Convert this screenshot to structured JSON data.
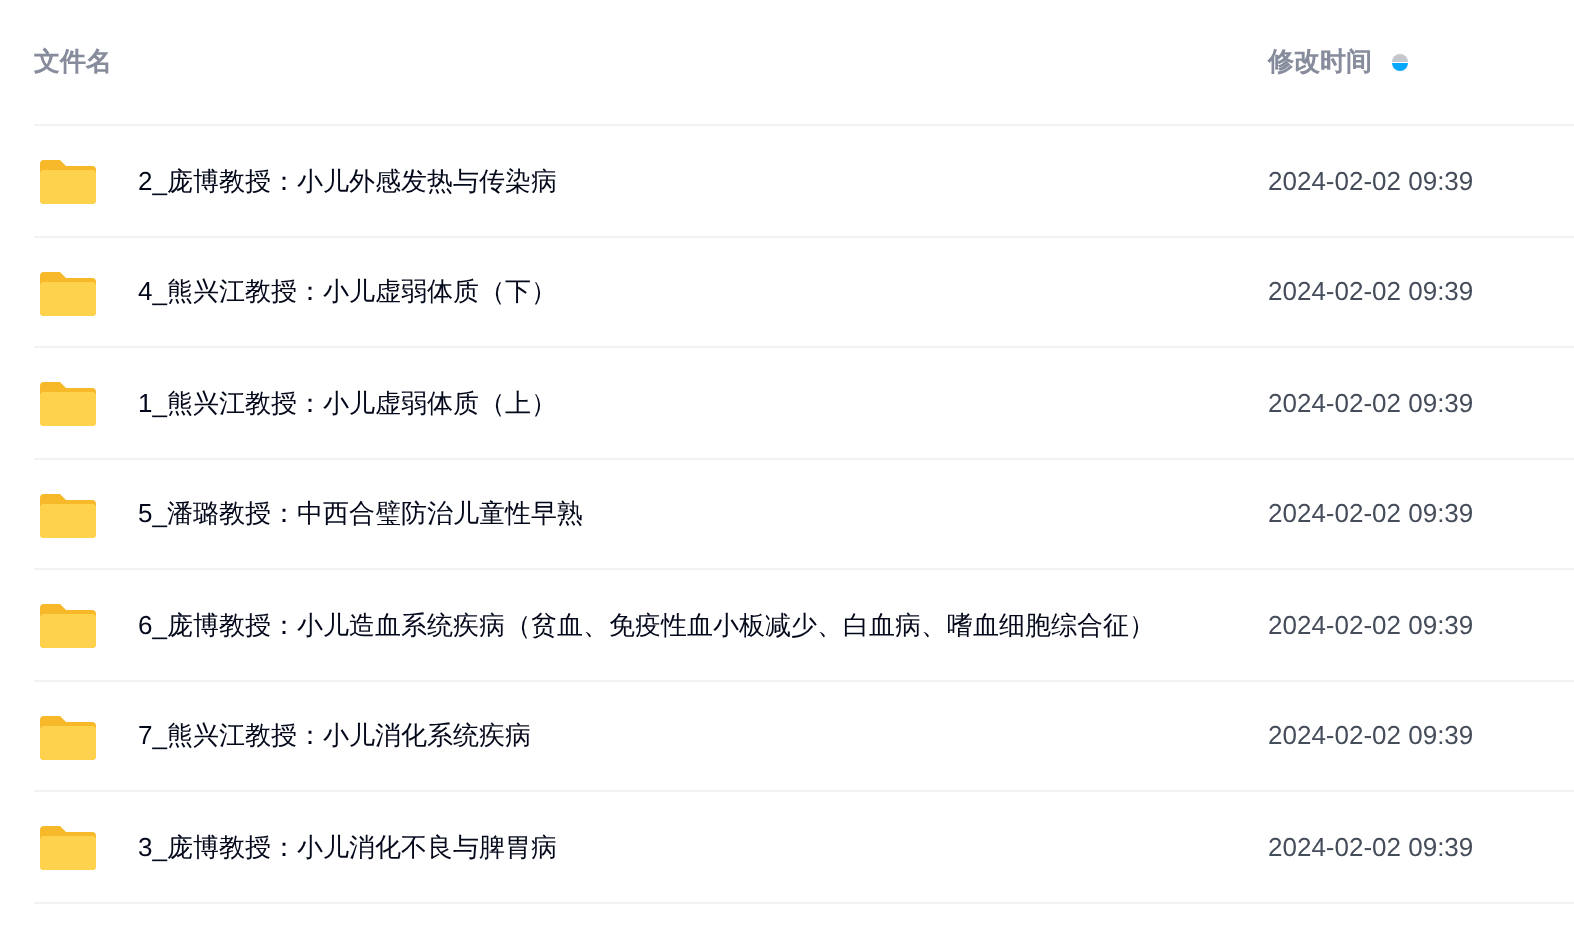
{
  "columns": [
    {
      "label": "文件名"
    },
    {
      "label": "修改时间",
      "sort_descending": true
    }
  ],
  "rows": [
    {
      "name": "2_庞博教授：小儿外感发热与传染病",
      "modified": "2024-02-02 09:39"
    },
    {
      "name": "4_熊兴江教授：小儿虚弱体质（下）",
      "modified": "2024-02-02 09:39"
    },
    {
      "name": "1_熊兴江教授：小儿虚弱体质（上）",
      "modified": "2024-02-02 09:39"
    },
    {
      "name": "5_潘璐教授：中西合璧防治儿童性早熟",
      "modified": "2024-02-02 09:39"
    },
    {
      "name": "6_庞博教授：小儿造血系统疾病（贫血、免疫性血小板减少、白血病、嗜血细胞综合征）",
      "modified": "2024-02-02 09:39"
    },
    {
      "name": "7_熊兴江教授：小儿消化系统疾病",
      "modified": "2024-02-02 09:39"
    },
    {
      "name": "3_庞博教授：小儿消化不良与脾胃病",
      "modified": "2024-02-02 09:39"
    }
  ]
}
